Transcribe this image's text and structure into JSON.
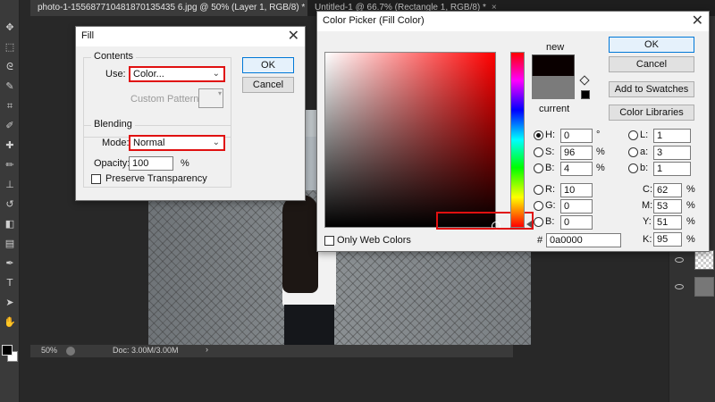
{
  "workspace": {
    "tabs": [
      {
        "label": "photo-1-155687710481870135435 6.jpg @ 50% (Layer 1, RGB/8) *",
        "close": "×"
      },
      {
        "label": "Untitled-1 @ 66.7% (Rectangle 1, RGB/8) *",
        "close": "×"
      }
    ],
    "status": {
      "zoom": "50%",
      "doc": "Doc: 3.00M/3.00M",
      "arrow": "›"
    }
  },
  "fill_dialog": {
    "title": "Fill",
    "close": "✕",
    "contents": {
      "legend": "Contents",
      "use_label": "Use:",
      "use_value": "Color...",
      "custom_pattern_label": "Custom Pattern:"
    },
    "blending": {
      "legend": "Blending",
      "mode_label": "Mode:",
      "mode_value": "Normal",
      "opacity_label": "Opacity:",
      "opacity_value": "100",
      "opacity_unit": "%",
      "preserve_label": "Preserve Transparency"
    },
    "buttons": {
      "ok": "OK",
      "cancel": "Cancel"
    }
  },
  "color_picker": {
    "title": "Color Picker (Fill Color)",
    "close": "✕",
    "new_label": "new",
    "current_label": "current",
    "new_color": "#0a0000",
    "current_color": "#7b7b7b",
    "buttons": {
      "ok": "OK",
      "cancel": "Cancel",
      "add": "Add to Swatches",
      "libraries": "Color Libraries"
    },
    "hsb": [
      {
        "label": "H:",
        "value": "0",
        "unit": "°",
        "selected": true
      },
      {
        "label": "S:",
        "value": "96",
        "unit": "%",
        "selected": false
      },
      {
        "label": "B:",
        "value": "4",
        "unit": "%",
        "selected": false
      }
    ],
    "rgb": [
      {
        "label": "R:",
        "value": "10"
      },
      {
        "label": "G:",
        "value": "0"
      },
      {
        "label": "B:",
        "value": "0"
      }
    ],
    "lab": [
      {
        "label": "L:",
        "value": "1"
      },
      {
        "label": "a:",
        "value": "3"
      },
      {
        "label": "b:",
        "value": "1"
      }
    ],
    "cmyk": [
      {
        "label": "C:",
        "value": "62",
        "unit": "%"
      },
      {
        "label": "M:",
        "value": "53",
        "unit": "%"
      },
      {
        "label": "Y:",
        "value": "51",
        "unit": "%"
      },
      {
        "label": "K:",
        "value": "95",
        "unit": "%"
      }
    ],
    "only_web_label": "Only Web Colors",
    "hex_label": "#",
    "hex_value": "0a0000"
  },
  "colors": {
    "highlight": "#e01010",
    "hue_base": "#ff0000"
  }
}
